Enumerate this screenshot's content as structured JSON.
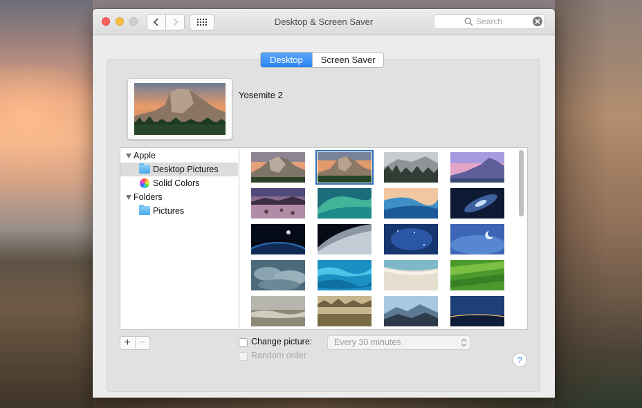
{
  "window": {
    "title": "Desktop & Screen Saver"
  },
  "search": {
    "placeholder": "Search"
  },
  "tabs": [
    {
      "label": "Desktop",
      "selected": true
    },
    {
      "label": "Screen Saver",
      "selected": false
    }
  ],
  "current_wallpaper": {
    "name": "Yosemite 2"
  },
  "sidebar": {
    "groups": [
      {
        "label": "Apple",
        "items": [
          {
            "label": "Desktop Pictures",
            "icon": "folder-icon",
            "selected": true
          },
          {
            "label": "Solid Colors",
            "icon": "color-wheel-icon",
            "selected": false
          }
        ]
      },
      {
        "label": "Folders",
        "items": [
          {
            "label": "Pictures",
            "icon": "folder-icon",
            "selected": false
          }
        ]
      }
    ]
  },
  "thumbnails": [
    {
      "icon": "yosemite-thumbnail",
      "selected": false
    },
    {
      "icon": "yosemite-2-thumbnail",
      "selected": true
    },
    {
      "icon": "forest-thumbnail",
      "selected": false
    },
    {
      "icon": "half-dome-thumbnail",
      "selected": false
    },
    {
      "icon": "lake-thumbnail",
      "selected": false
    },
    {
      "icon": "wave-green-thumbnail",
      "selected": false
    },
    {
      "icon": "wave-blue-thumbnail",
      "selected": false
    },
    {
      "icon": "galaxy-thumbnail",
      "selected": false
    },
    {
      "icon": "earth-horizon-thumbnail",
      "selected": false
    },
    {
      "icon": "earth-clouds-thumbnail",
      "selected": false
    },
    {
      "icon": "nebula-thumbnail",
      "selected": false
    },
    {
      "icon": "blue-moon-thumbnail",
      "selected": false
    },
    {
      "icon": "clouds-thumbnail",
      "selected": false
    },
    {
      "icon": "aerial-water-thumbnail",
      "selected": false
    },
    {
      "icon": "beach-thumbnail",
      "selected": false
    },
    {
      "icon": "green-fields-thumbnail",
      "selected": false
    },
    {
      "icon": "fog-thumbnail",
      "selected": false
    },
    {
      "icon": "misty-forest-thumbnail",
      "selected": false
    },
    {
      "icon": "mountain-valley-thumbnail",
      "selected": false
    },
    {
      "icon": "city-lights-thumbnail",
      "selected": false
    }
  ],
  "footer": {
    "change_picture_label": "Change picture:",
    "change_picture_checked": false,
    "interval_value": "Every 30 minutes",
    "random_order_label": "Random order",
    "random_order_checked": false,
    "help_label": "?"
  }
}
